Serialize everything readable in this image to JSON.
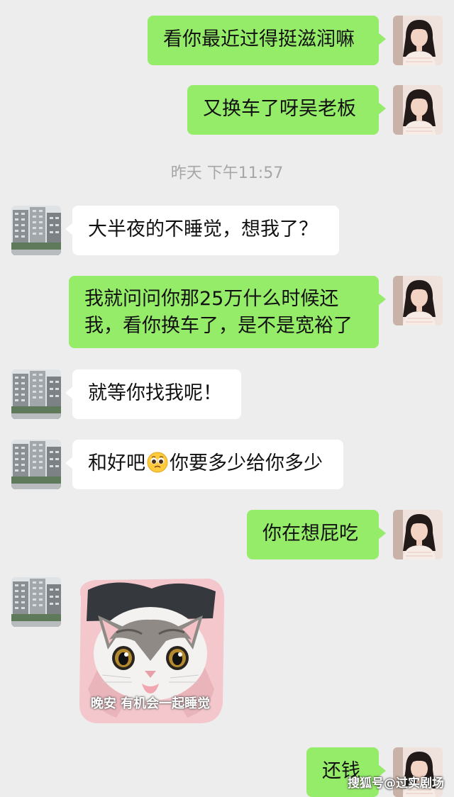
{
  "chat": {
    "timestamp": "昨天 下午11:57",
    "messages": [
      {
        "text": "看你最近过得挺滋润嘛"
      },
      {
        "text": "又换车了呀吴老板"
      },
      {
        "text": "大半夜的不睡觉，想我了？"
      },
      {
        "text": "我就问问你那25万什么时候还我，看你换车了，是不是宽裕了"
      },
      {
        "text": "就等你找我呢！"
      },
      {
        "text_before": "和好吧",
        "emoji": "pleading-face-icon",
        "text_after": "你要多少给你多少"
      },
      {
        "text": "你在想屁吃"
      },
      {
        "sticker_caption": "晚安 有机会一起睡觉"
      },
      {
        "text": "还钱"
      }
    ]
  },
  "watermark": "搜狐号@过实剧场",
  "colors": {
    "background": "#ededed",
    "my_bubble": "#95ec69",
    "their_bubble": "#ffffff",
    "timestamp_text": "#a6a6a6"
  },
  "icons": {
    "my_avatar": "woman-portrait-avatar",
    "their_avatar": "apartment-building-avatar"
  }
}
